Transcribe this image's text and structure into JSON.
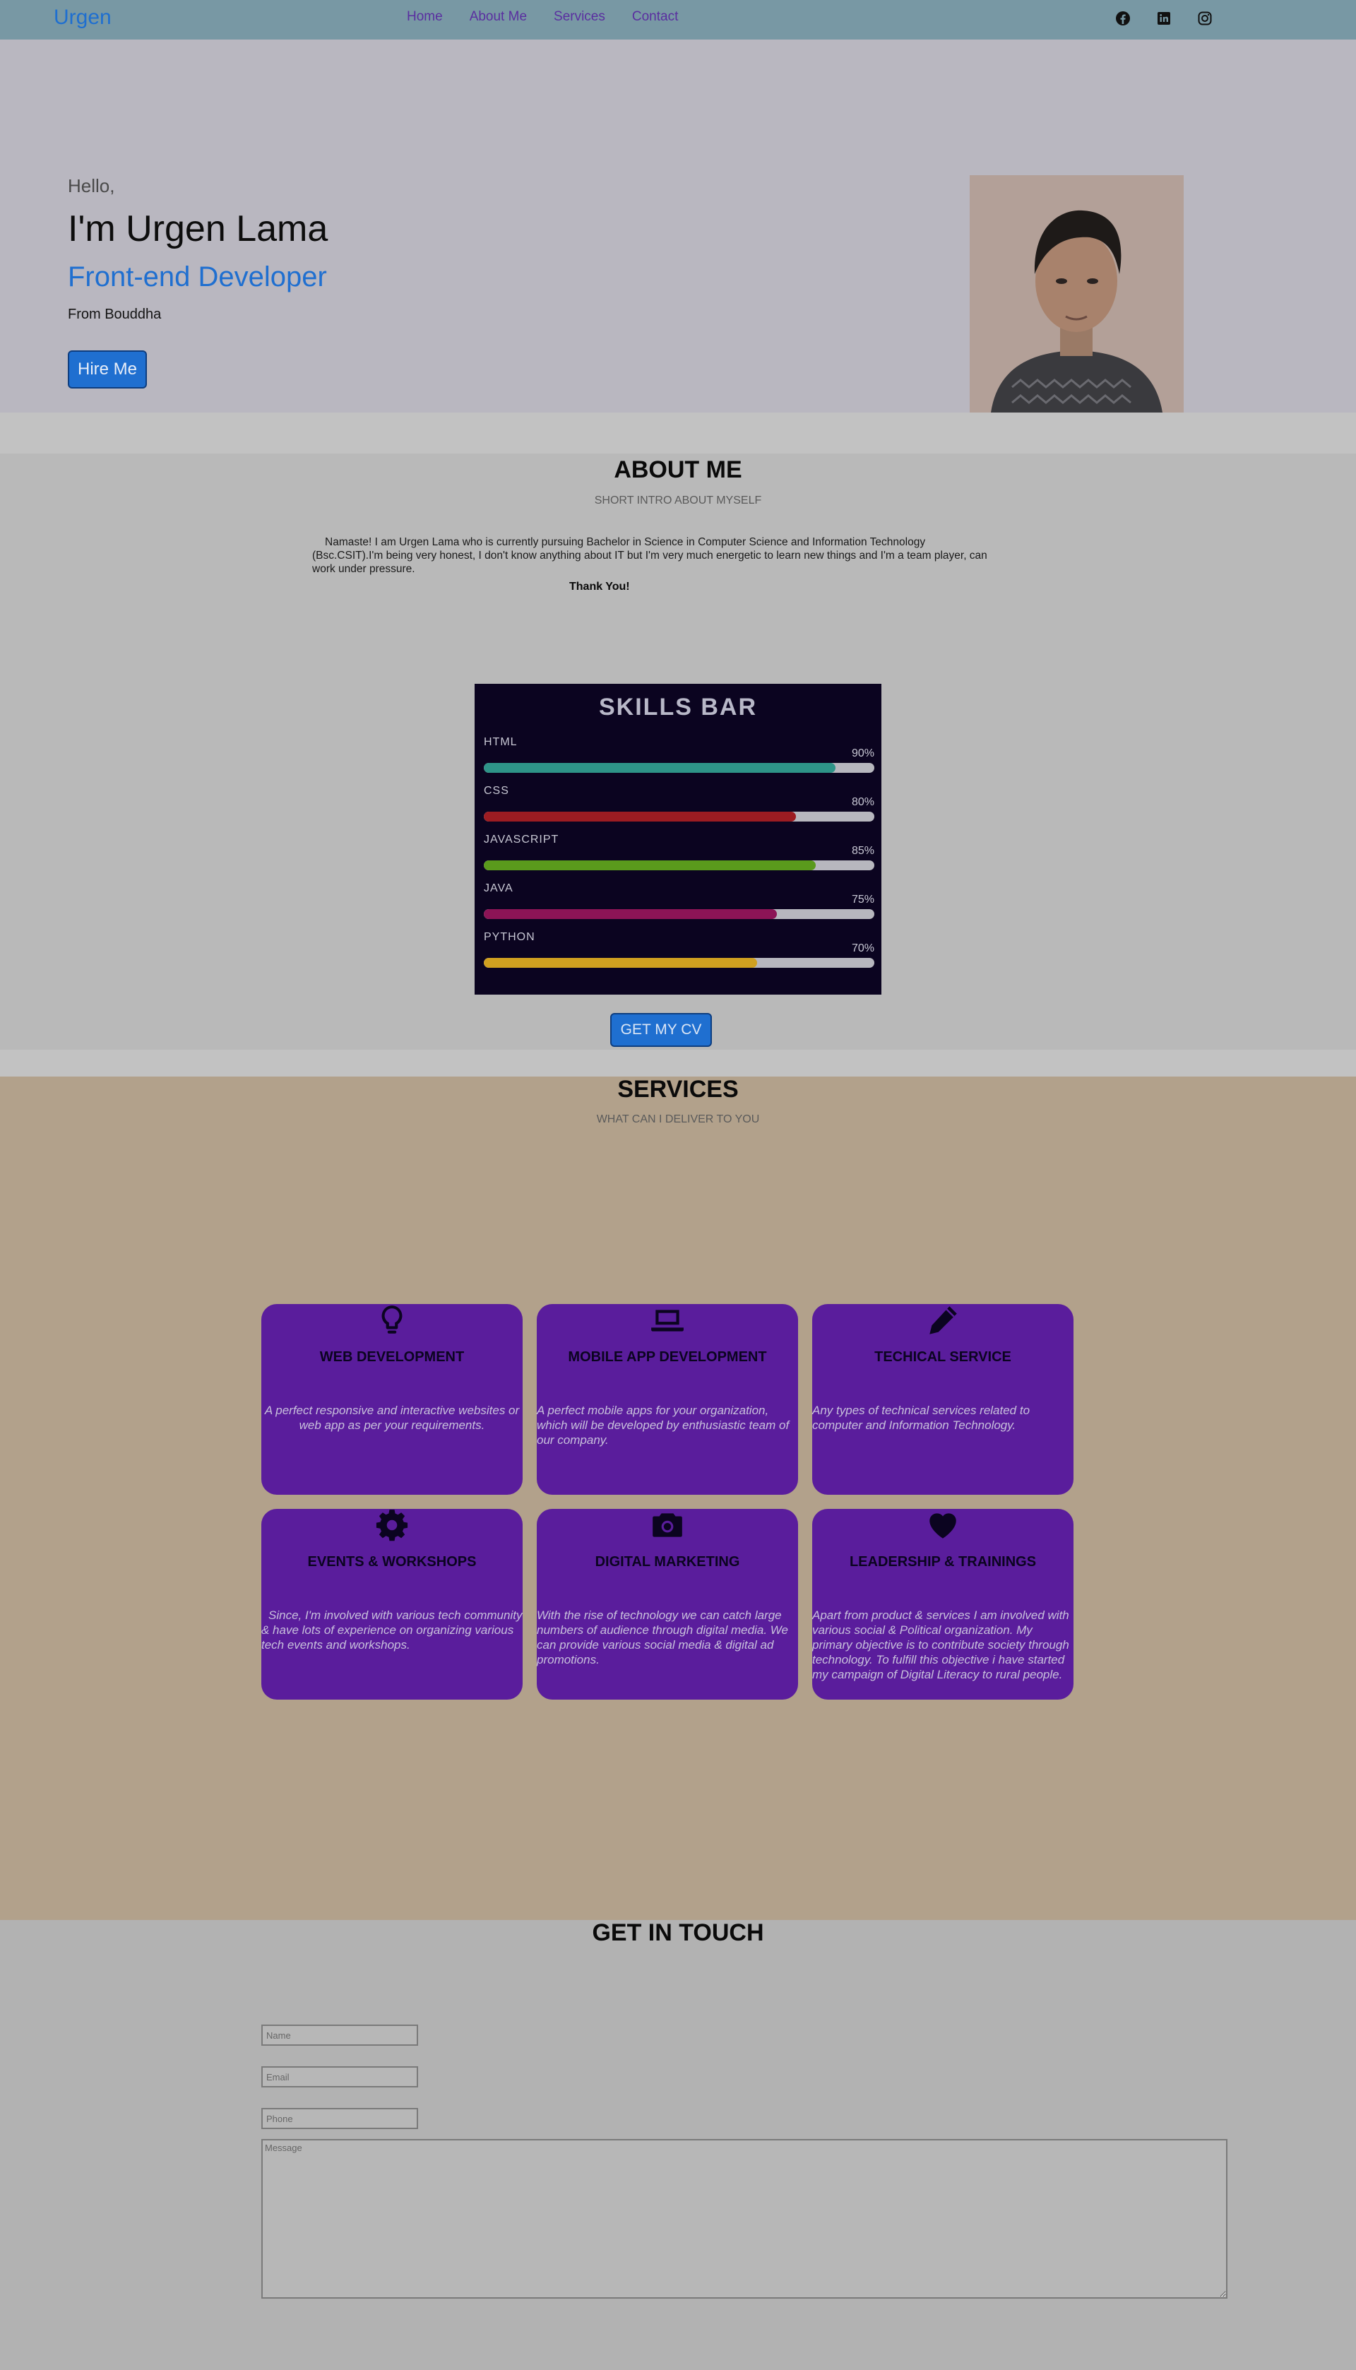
{
  "nav": {
    "brand": "Urgen",
    "links": [
      "Home",
      "About Me",
      "Services",
      "Contact"
    ],
    "social_icons": [
      "facebook-icon",
      "linkedin-icon",
      "instagram-icon"
    ]
  },
  "hero": {
    "greeting": "Hello,",
    "name": "I'm Urgen Lama",
    "role": "Front-end Developer",
    "from": "From Bouddha",
    "hire_label": "Hire Me"
  },
  "about": {
    "title": "ABOUT ME",
    "subtitle": "SHORT INTRO ABOUT MYSELF",
    "text": "Namaste! I am Urgen Lama who is currently pursuing Bachelor in Science in Computer Science and Information Technology (Bsc.CSIT).I'm being very honest, I don't know anything about IT but I'm very much energetic to learn new things and I'm a team player, can work under pressure.",
    "thanks": "Thank You!",
    "cv_label": "GET MY CV"
  },
  "skills": {
    "title": "SKILLS BAR",
    "items": [
      {
        "name": "HTML",
        "percent": "90%",
        "value": 90,
        "color": "#2e9488"
      },
      {
        "name": "CSS",
        "percent": "80%",
        "value": 80,
        "color": "#9c1c22"
      },
      {
        "name": "JAVASCRIPT",
        "percent": "85%",
        "value": 85,
        "color": "#5a9a1c"
      },
      {
        "name": "JAVA",
        "percent": "75%",
        "value": 75,
        "color": "#8c1456"
      },
      {
        "name": "PYTHON",
        "percent": "70%",
        "value": 70,
        "color": "#d0a020"
      }
    ]
  },
  "services": {
    "title": "SERVICES",
    "subtitle": "WHAT CAN I DELIVER TO YOU",
    "cards": [
      {
        "icon": "lightbulb-icon",
        "title": "WEB DEVELOPMENT",
        "desc": "A perfect responsive and interactive websites or web app as per your requirements."
      },
      {
        "icon": "laptop-icon",
        "title": "MOBILE APP DEVELOPMENT",
        "desc": "A perfect mobile apps for your organization, which will be developed by enthusiastic team of our company."
      },
      {
        "icon": "pencil-icon",
        "title": "TECHICAL SERVICE",
        "desc": "Any types of technical services related to computer and Information Technology."
      },
      {
        "icon": "gear-icon",
        "title": "EVENTS & WORKSHOPS",
        "desc": "Since, I'm involved with various tech community & have lots of experience on organizing various tech events and workshops."
      },
      {
        "icon": "camera-icon",
        "title": "DIGITAL MARKETING",
        "desc": "With the rise of technology we can catch large numbers of audience through digital media. We can provide various social media & digital ad promotions."
      },
      {
        "icon": "heart-icon",
        "title": "LEADERSHIP & TRAININGS",
        "desc": "Apart from product & services I am involved with various social & Political organization. My primary objective is to contribute society through technology. To fulfill this objective i have started my campaign of Digital Literacy to rural people."
      }
    ]
  },
  "contact": {
    "title": "GET IN TOUCH",
    "name_placeholder": "Name",
    "email_placeholder": "Email",
    "phone_placeholder": "Phone",
    "message_placeholder": "Message"
  }
}
